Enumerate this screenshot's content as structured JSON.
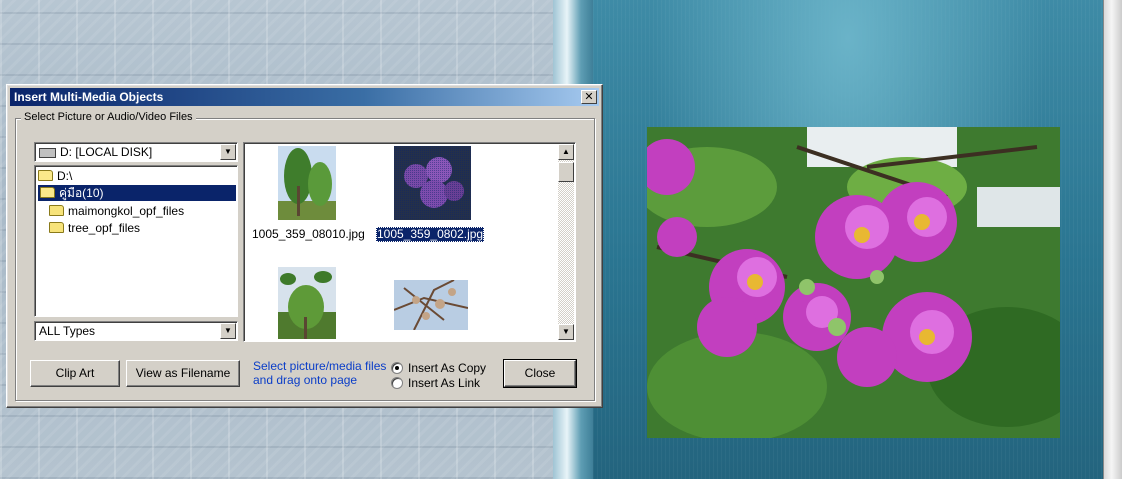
{
  "dialog": {
    "title": "Insert Multi-Media Objects",
    "close_glyph": "✕",
    "group_label": "Select Picture or Audio/Video Files",
    "drive_combo": {
      "value": "D: [LOCAL DISK]",
      "arrow": "▼"
    },
    "folder_tree": [
      {
        "label": "D:\\",
        "state": "open"
      },
      {
        "label": "คู่มือ(10)",
        "state": "selected"
      },
      {
        "label": "maimongkol_opf_files",
        "state": "closed"
      },
      {
        "label": "tree_opf_files",
        "state": "closed"
      }
    ],
    "type_combo": {
      "value": "ALL Types",
      "arrow": "▼"
    },
    "thumbnails": [
      {
        "label": "1005_359_08010.jpg",
        "selected": false
      },
      {
        "label": "1005_359_0802.jpg",
        "selected": true
      },
      {
        "label": "",
        "selected": false
      },
      {
        "label": "",
        "selected": false
      }
    ],
    "scroll_up": "▲",
    "scroll_down": "▼",
    "buttons": {
      "clip_art": "Clip Art",
      "view_as_filename": "View as Filename",
      "close": "Close"
    },
    "hint": "Select picture/media files and drag onto page",
    "insert_options": [
      {
        "label": "Insert As Copy",
        "checked": true
      },
      {
        "label": "Insert As Link",
        "checked": false
      }
    ]
  },
  "colors": {
    "title_bar_start": "#0a246a",
    "selection": "#0a246a",
    "hint_text": "#0a3dc8",
    "dialog_face": "#d4d0c8"
  }
}
